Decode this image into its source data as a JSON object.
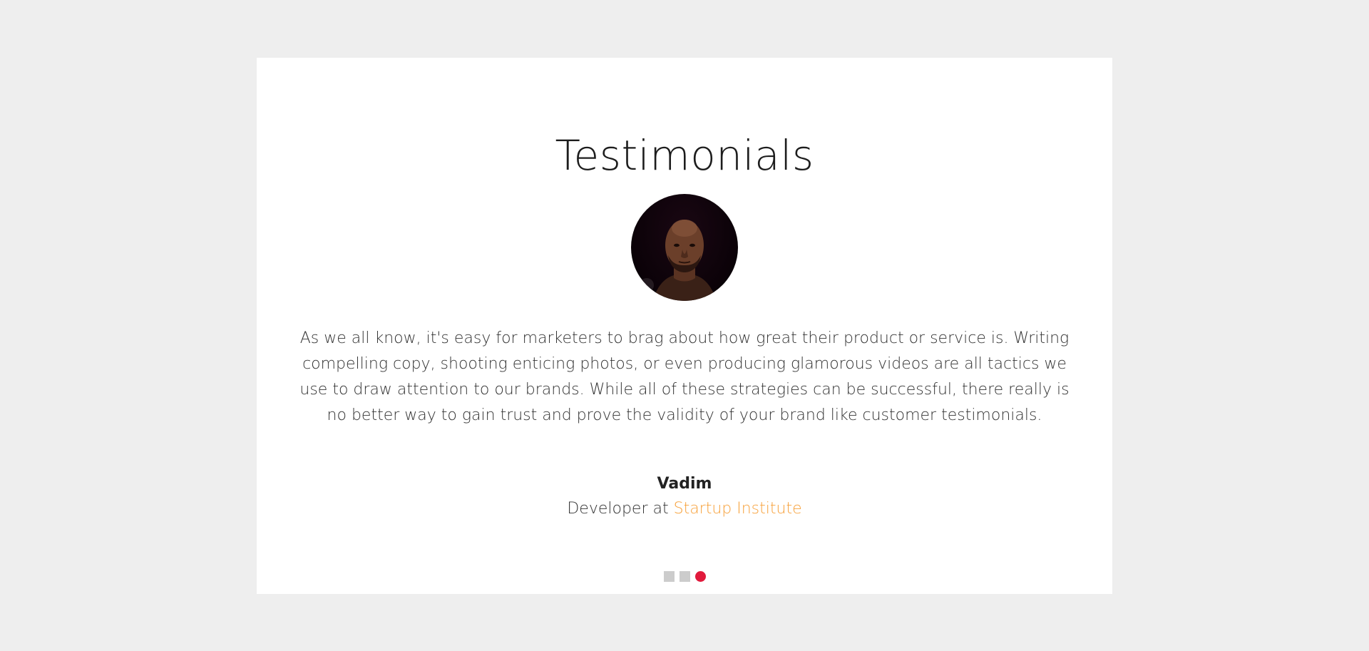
{
  "testimonials": {
    "title": "Testimonials",
    "quote": "As we all know, it's easy for marketers to brag about how great their product or service is. Writing compelling copy, shooting enticing photos, or even producing glamorous videos are all tactics we use to draw attention to our brands. While all of these strategies can be successful, there really is no better way to gain trust and prove the validity of your brand like customer testimonials.",
    "author_name": "Vadim",
    "role_prefix": "Developer at ",
    "company": "Startup Institute",
    "avatar_icon": "person-portrait",
    "pager": {
      "count": 3,
      "active_index": 2
    }
  },
  "colors": {
    "background": "#eeeeee",
    "card": "#ffffff",
    "link": "#f7a13b",
    "active_dot": "#e11a3c",
    "inactive_dot": "#cccccc"
  }
}
